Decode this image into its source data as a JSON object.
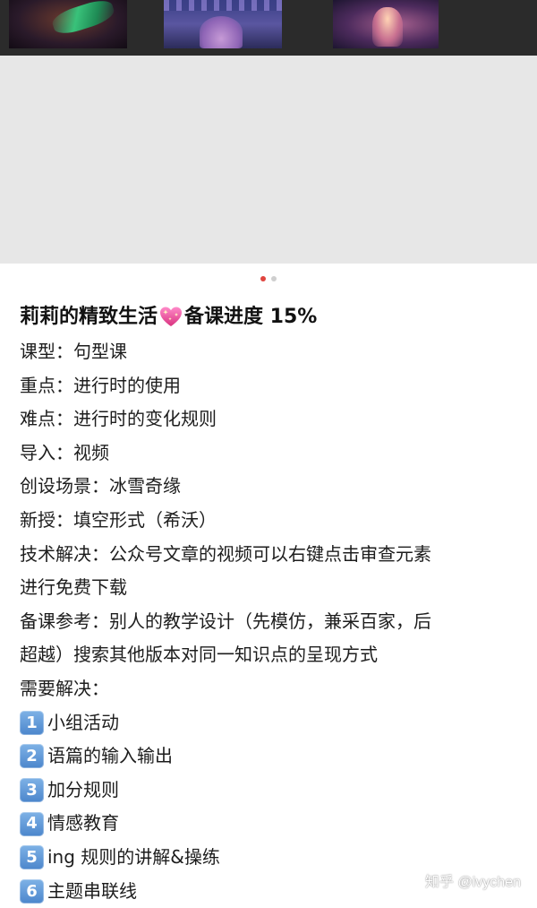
{
  "carousel": {
    "dot_count": 2,
    "active_index": 0
  },
  "post": {
    "title_before": "莉莉的精致生活",
    "title_after": "备课进度 15%",
    "lines": [
      "课型：句型课",
      "重点：进行时的使用",
      "难点：进行时的变化规则",
      "导入：视频",
      "创设场景：冰雪奇缘",
      "新授：填空形式（希沃）",
      "技术解决：公众号文章的视频可以右键点击审查元素",
      "进行免费下载",
      "备课参考：别人的教学设计（先模仿，兼采百家，后",
      "超越）搜索其他版本对同一知识点的呈现方式",
      "需要解决："
    ],
    "items": [
      {
        "num": "1",
        "text": "小组活动"
      },
      {
        "num": "2",
        "text": "语篇的输入输出"
      },
      {
        "num": "3",
        "text": "加分规则"
      },
      {
        "num": "4",
        "text": "情感教育"
      },
      {
        "num": "5",
        "text": "ing 规则的讲解&操练"
      },
      {
        "num": "6",
        "text": "主题串联线"
      }
    ]
  },
  "watermark": "知乎 @ivychen",
  "icons": {
    "title_emoji": "sparkling-heart-icon"
  },
  "colors": {
    "active_dot": "#e0453f",
    "inactive_dot": "#cfcfcf",
    "badge": "#5a93d6"
  }
}
